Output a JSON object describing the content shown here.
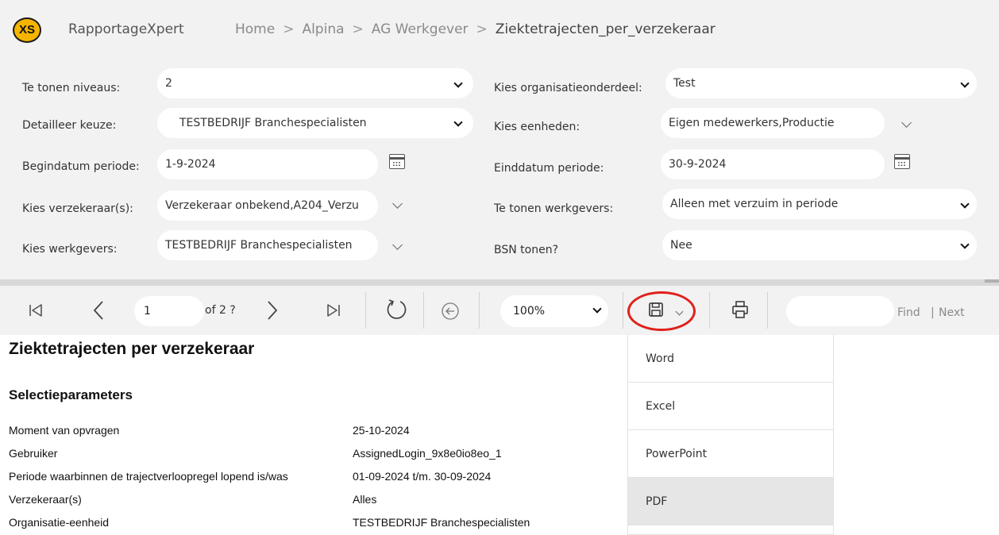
{
  "header": {
    "logo": "XS",
    "app_name": "RapportageXpert",
    "breadcrumb": [
      "Home",
      "Alpina",
      "AG Werkgever",
      "Ziektetrajecten_per_verzekeraar"
    ],
    "separator": ">"
  },
  "params": {
    "niveaus": {
      "label": "Te tonen niveaus:",
      "value": "2"
    },
    "detail": {
      "label": "Detailleer keuze:",
      "value": "TESTBEDRIJF Branchespecialisten"
    },
    "begindatum": {
      "label": "Begindatum periode:",
      "value": "1-9-2024"
    },
    "verzekeraar": {
      "label": "Kies verzekeraar(s):",
      "value": "Verzekeraar onbekend,A204_Verzu"
    },
    "werkgevers": {
      "label": "Kies werkgevers:",
      "value": "TESTBEDRIJF Branchespecialisten"
    },
    "organisatie": {
      "label": "Kies organisatieonderdeel:",
      "value": "Test"
    },
    "eenheden": {
      "label": "Kies eenheden:",
      "value": "Eigen medewerkers,Productie"
    },
    "einddatum": {
      "label": "Einddatum periode:",
      "value": "30-9-2024"
    },
    "tonen_werkgevers": {
      "label": "Te tonen werkgevers:",
      "value": "Alleen met verzuim in periode"
    },
    "bsn": {
      "label": "BSN tonen?",
      "value": "Nee"
    }
  },
  "toolbar": {
    "page": "1",
    "of_pages": "of 2 ?",
    "zoom": "100%",
    "find": "Find",
    "next_sep": "|",
    "next": "Next"
  },
  "export_menu": {
    "items": [
      "Word",
      "Excel",
      "PowerPoint",
      "PDF"
    ],
    "active_item": "PDF"
  },
  "report": {
    "title": "Ziektetrajecten per verzekeraar",
    "section": "Selectieparameters",
    "rows": [
      {
        "label": "Moment van opvragen",
        "value": "25-10-2024"
      },
      {
        "label": "Gebruiker",
        "value": "AssignedLogin_9x8e0io8eo_1"
      },
      {
        "label": "Periode waarbinnen de trajectverloopregel lopend is/was",
        "value": "01-09-2024 t/m. 30-09-2024"
      },
      {
        "label": "Verzekeraar(s)",
        "value": "Alles"
      },
      {
        "label": "Organisatie-eenheid",
        "value": "TESTBEDRIJF Branchespecialisten"
      }
    ]
  },
  "colors": {
    "logo": "#f5b400",
    "highlight": "#e0201b",
    "panel": "#f2f2f2"
  }
}
